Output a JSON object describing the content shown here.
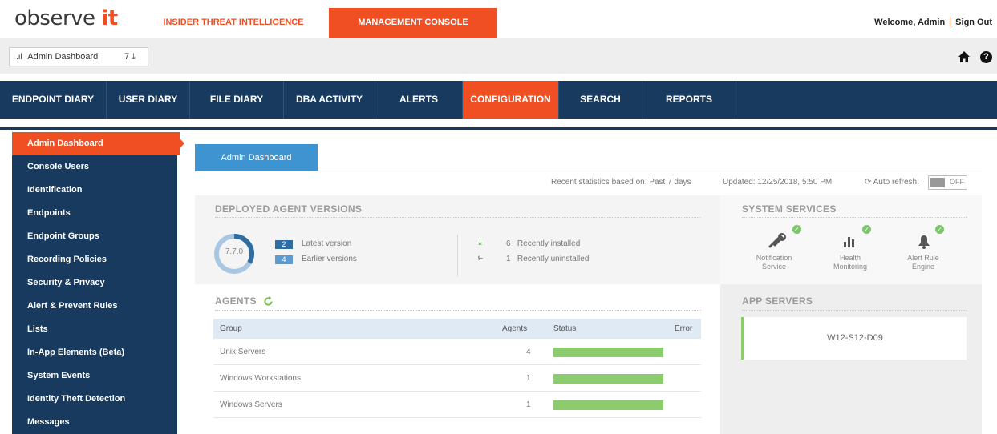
{
  "header": {
    "logo_text": "observe",
    "logo_accent": "it",
    "tab_insider": "INSIDER THREAT INTELLIGENCE",
    "tab_management": "MANAGEMENT CONSOLE",
    "welcome": "Welcome, Admin",
    "sign_out": "Sign Out"
  },
  "dashboard_select": {
    "icon": "bar-chart-icon",
    "label": "Admin Dashboard",
    "count": "7"
  },
  "nav": {
    "items": [
      {
        "label": "ENDPOINT DIARY"
      },
      {
        "label": "USER DIARY"
      },
      {
        "label": "FILE DIARY"
      },
      {
        "label": "DBA ACTIVITY"
      },
      {
        "label": "ALERTS"
      },
      {
        "label": "CONFIGURATION",
        "active": true
      },
      {
        "label": "SEARCH"
      },
      {
        "label": "REPORTS"
      }
    ]
  },
  "sidebar": {
    "items": [
      {
        "label": "Admin Dashboard",
        "active": true
      },
      {
        "label": "Console Users"
      },
      {
        "label": "Identification"
      },
      {
        "label": "Endpoints"
      },
      {
        "label": "Endpoint Groups"
      },
      {
        "label": "Recording Policies"
      },
      {
        "label": "Security & Privacy"
      },
      {
        "label": "Alert & Prevent Rules"
      },
      {
        "label": "Lists"
      },
      {
        "label": "In-App Elements (Beta)"
      },
      {
        "label": "System Events"
      },
      {
        "label": "Identity Theft Detection"
      },
      {
        "label": "Messages"
      }
    ]
  },
  "content": {
    "tab": "Admin Dashboard",
    "stats_basis": "Recent statistics based on: Past 7 days",
    "updated": "Updated: 12/25/2018, 5:50 PM",
    "auto_refresh": "Auto refresh:",
    "auto_refresh_state": "OFF"
  },
  "deployed": {
    "title": "DEPLOYED AGENT VERSIONS",
    "version": "7.7.0",
    "latest_count": "2",
    "latest_label": "Latest version",
    "earlier_count": "4",
    "earlier_label": "Earlier versions",
    "installed_count": "6",
    "installed_label": "Recently installed",
    "uninstalled_count": "1",
    "uninstalled_label": "Recently uninstalled"
  },
  "services": {
    "title": "SYSTEM SERVICES",
    "items": [
      {
        "line1": "Notification",
        "line2": "Service",
        "icon": "tools-icon"
      },
      {
        "line1": "Health",
        "line2": "Monitoring",
        "icon": "bar-chart-icon"
      },
      {
        "line1": "Alert Rule",
        "line2": "Engine",
        "icon": "bell-icon"
      }
    ]
  },
  "agents": {
    "title": "AGENTS",
    "columns": {
      "group": "Group",
      "agents": "Agents",
      "status": "Status",
      "error": "Error"
    },
    "rows": [
      {
        "group": "Unix Servers",
        "agents": "4",
        "status_ok": 1.0
      },
      {
        "group": "Windows Workstations",
        "agents": "1",
        "status_ok": 1.0
      },
      {
        "group": "Windows Servers",
        "agents": "1",
        "status_ok": 1.0
      }
    ]
  },
  "app_servers": {
    "title": "APP SERVERS",
    "items": [
      {
        "name": "W12-S12-D09"
      }
    ]
  },
  "colors": {
    "accent": "#f04e23",
    "nav": "#173a5e",
    "tab_blue": "#3d94d1",
    "status_green": "#8dcc6e"
  }
}
